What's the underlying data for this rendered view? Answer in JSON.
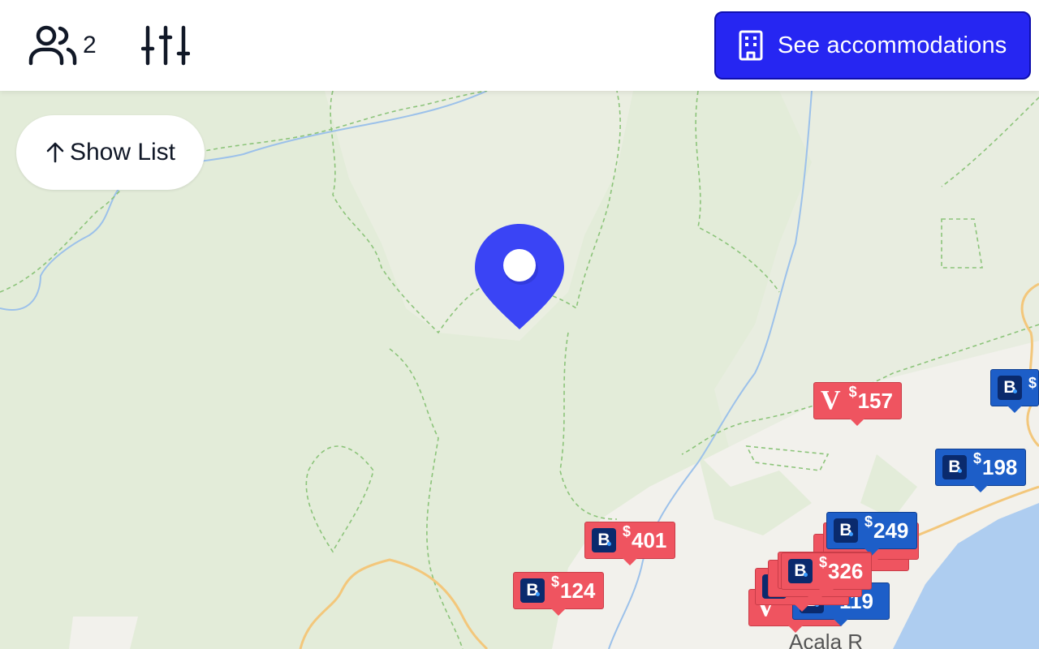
{
  "header": {
    "guests_icon": "users-icon",
    "guest_count": "2",
    "filter_icon": "sliders-icon",
    "accommodations_button": {
      "icon": "building-icon",
      "label": "See accommodations"
    }
  },
  "map": {
    "show_list_label": "Show List",
    "show_list_icon": "arrow-up-icon",
    "location_pin_icon": "map-pin-icon",
    "colors": {
      "booking": "#1d5ec8",
      "vrbo": "#ef5460",
      "pin": "#3a44f5",
      "button": "#2626f2"
    },
    "markers": [
      {
        "id": "m-157",
        "price": "157",
        "brand": "vrbo",
        "color": "red"
      },
      {
        "id": "m-198",
        "price": "198",
        "brand": "booking",
        "color": "blue"
      },
      {
        "id": "m-edge",
        "price": "",
        "brand": "booking",
        "color": "blue"
      },
      {
        "id": "m-249",
        "price": "249",
        "brand": "booking",
        "color": "blue"
      },
      {
        "id": "m-401",
        "price": "401",
        "brand": "booking",
        "color": "red"
      },
      {
        "id": "m-124",
        "price": "124",
        "brand": "booking",
        "color": "red"
      },
      {
        "id": "m-326",
        "price": "326",
        "brand": "booking",
        "color": "red"
      },
      {
        "id": "m-119",
        "price": "119",
        "brand": "booking",
        "color": "blue"
      }
    ],
    "currency_symbol": "$",
    "booking_letter": "B",
    "vrbo_letter": "V"
  }
}
